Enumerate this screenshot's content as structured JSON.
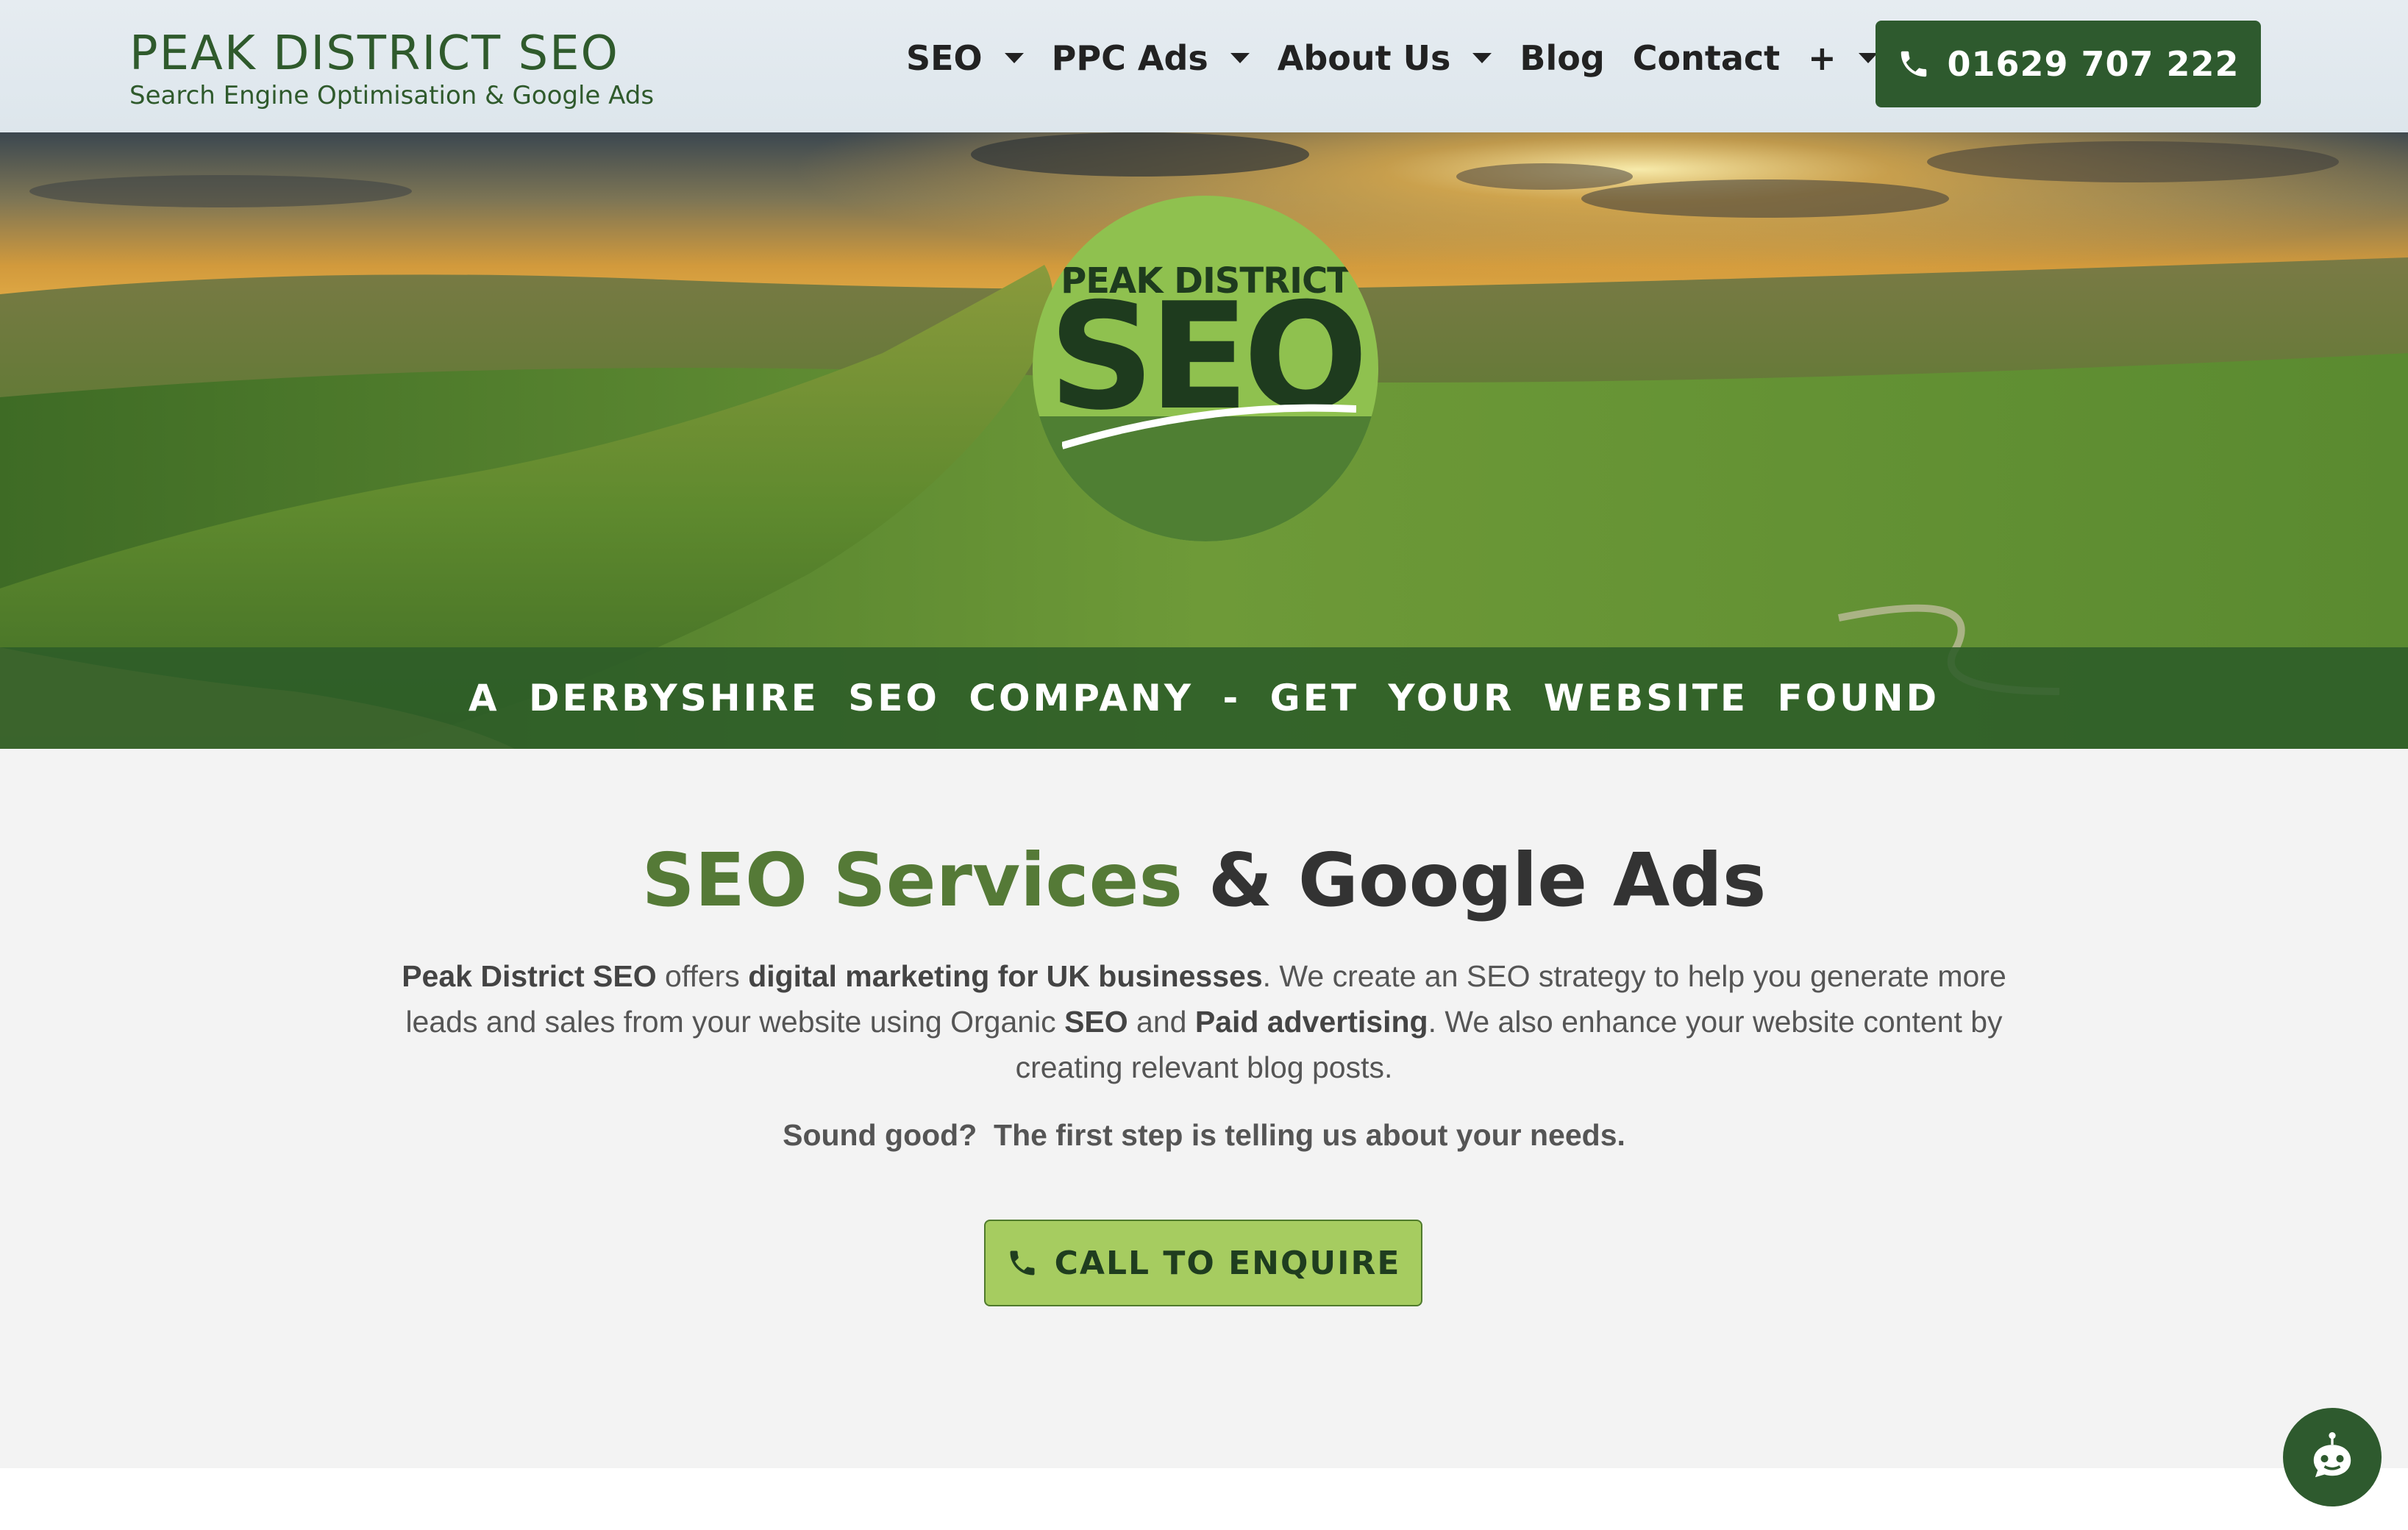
{
  "header": {
    "brand_title": "PEAK DISTRICT SEO",
    "brand_subtitle": "Search Engine Optimisation & Google Ads",
    "nav": [
      {
        "label": "SEO",
        "has_dropdown": true
      },
      {
        "label": "PPC Ads",
        "has_dropdown": true
      },
      {
        "label": "About Us",
        "has_dropdown": true
      },
      {
        "label": "Blog",
        "has_dropdown": false
      },
      {
        "label": "Contact",
        "has_dropdown": false
      },
      {
        "label": "+",
        "has_dropdown": true
      }
    ],
    "phone": "01629 707 222",
    "phone_icon": "phone-icon"
  },
  "hero": {
    "logo_top": "PEAK DISTRICT",
    "logo_main": "SEO",
    "tagline": "A DERBYSHIRE SEO COMPANY - GET YOUR WEBSITE FOUND"
  },
  "main": {
    "headline_green": "SEO Services",
    "headline_rest": "& Google Ads",
    "intro": {
      "p1": "Peak District SEO",
      "p2": " offers ",
      "p3": "digital marketing for UK businesses",
      "p4": ". We create an SEO strategy to help you generate more leads and sales from your website using Organic ",
      "p5": "SEO",
      "p6": " and ",
      "p7": "Paid advertising",
      "p8": ". We also enhance your website content by creating relevant blog posts."
    },
    "cta_text": "Sound good?  The first step is telling us about your needs.",
    "enquire_label": "CALL TO ENQUIRE"
  },
  "colors": {
    "dark_green": "#2e5a2e",
    "accent_green": "#557a37",
    "button_green": "#a6cc60"
  },
  "chat_icon": "chatbot-icon"
}
